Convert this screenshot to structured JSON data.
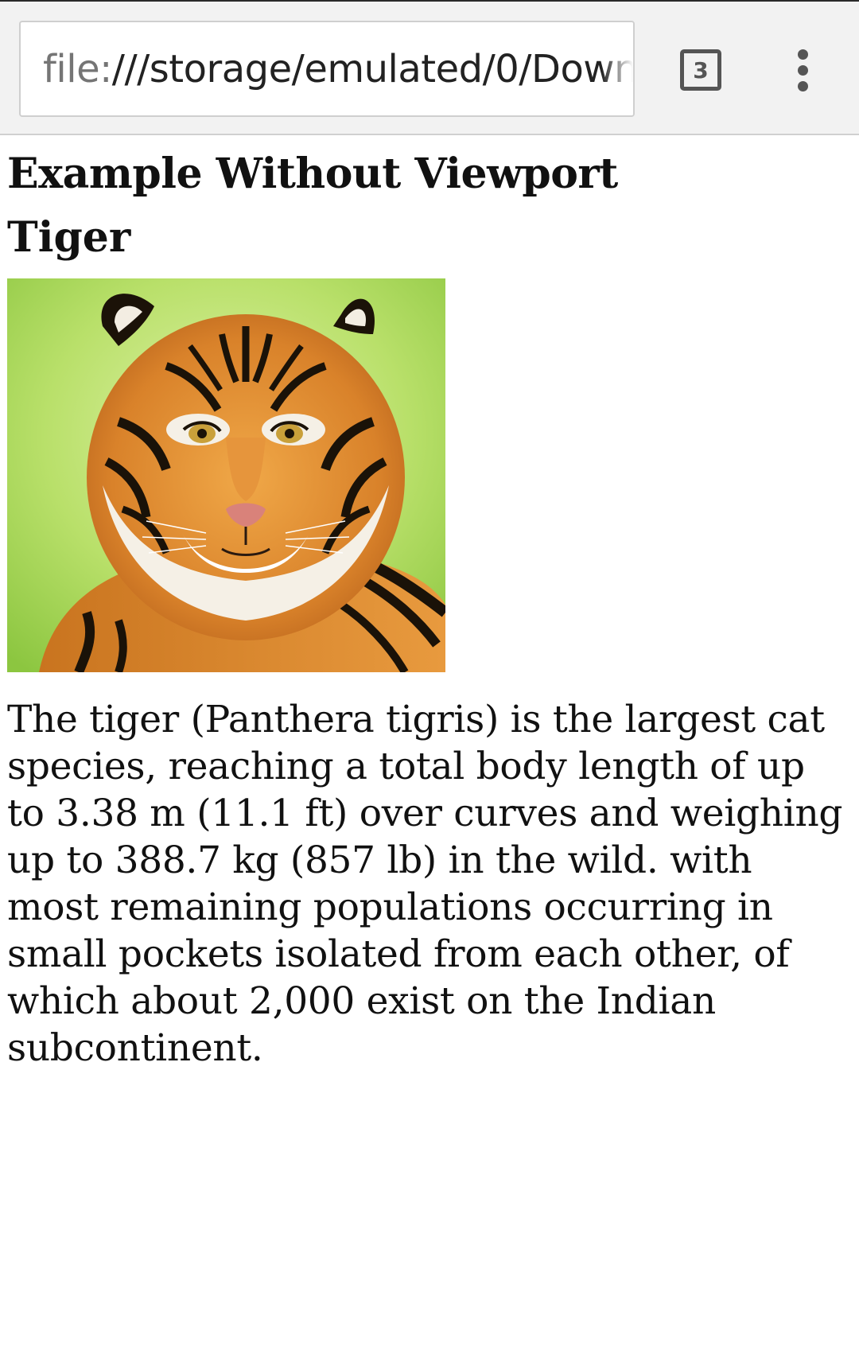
{
  "browser": {
    "url_scheme": "file:",
    "url_rest": "///storage/emulated/0/Downl",
    "tab_count": "3",
    "icons": {
      "tabs": "tab-switcher-icon",
      "menu": "more-vert-icon"
    }
  },
  "page": {
    "title": "Example Without Viewport",
    "heading": "Tiger",
    "image": {
      "subject": "tiger-photo"
    },
    "paragraph": "The tiger (Panthera tigris) is the largest cat species, reaching a total body length of up to 3.38 m (11.1 ft) over curves and weighing up to 388.7 kg (857 lb) in the wild. with most remaining populations occurring in small pockets isolated from each other, of which about 2,000 exist on the Indian subcontinent."
  },
  "colors": {
    "toolbar_bg": "#f2f2f2",
    "icon_gray": "#555555",
    "background_green": "#b8e06a",
    "tiger_orange": "#e08a2c"
  }
}
